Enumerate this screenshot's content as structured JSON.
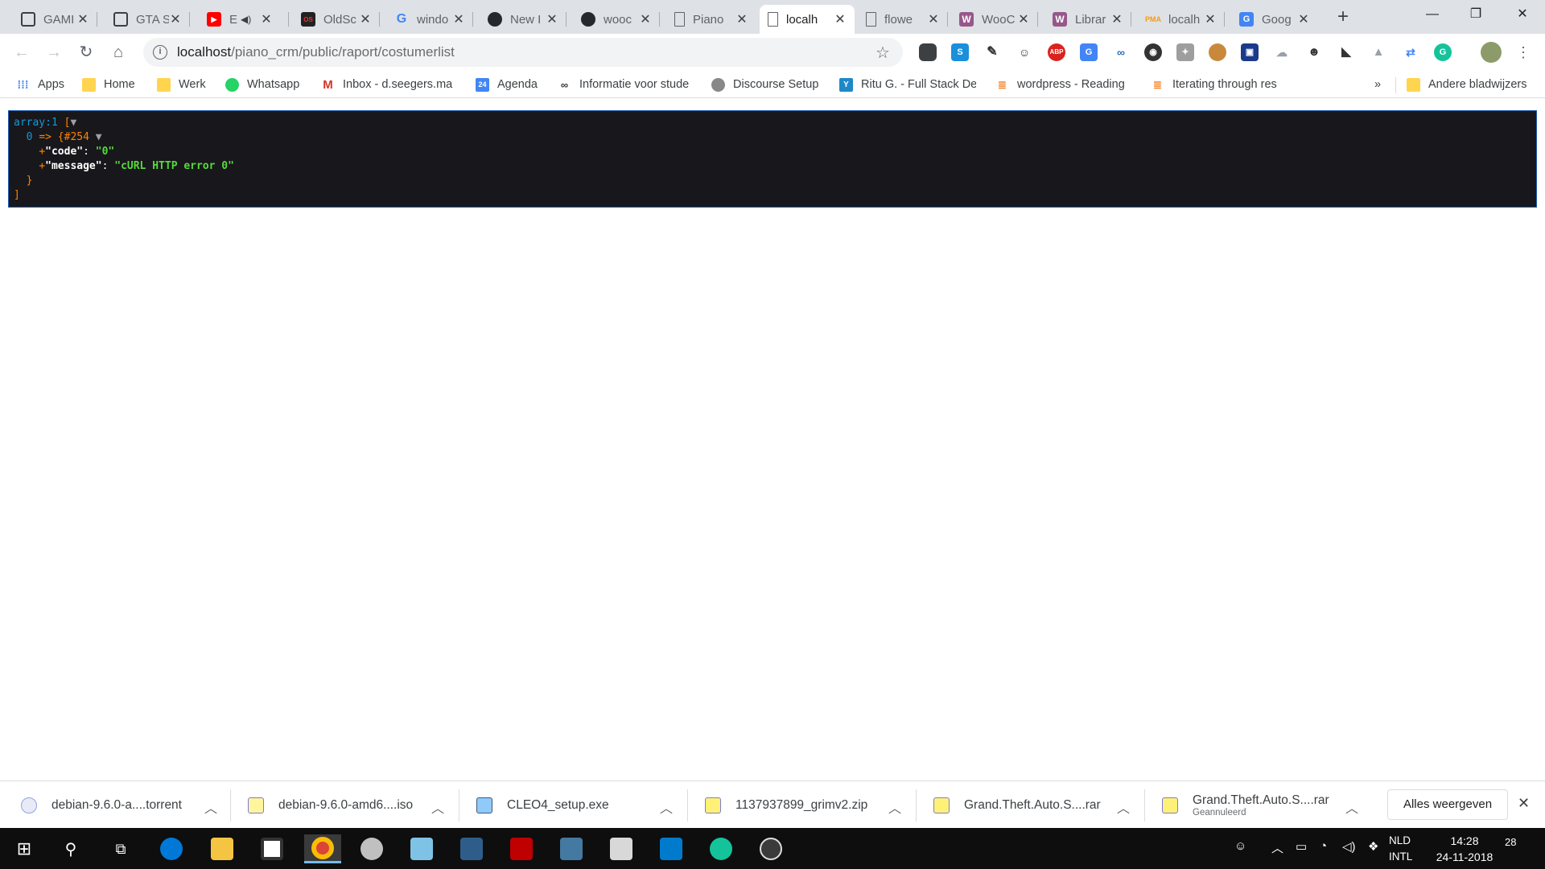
{
  "tabs": [
    {
      "title": "GAMI",
      "icon": "page-icon",
      "active": false
    },
    {
      "title": "GTA S",
      "icon": "page-icon",
      "active": false
    },
    {
      "title": "E",
      "icon": "youtube-icon",
      "active": false
    },
    {
      "title": "OldSc",
      "icon": "site-icon",
      "active": false
    },
    {
      "title": "windo",
      "icon": "google-icon",
      "active": false
    },
    {
      "title": "New I",
      "icon": "github-icon",
      "active": false
    },
    {
      "title": "wooc",
      "icon": "github-icon",
      "active": false
    },
    {
      "title": "Piano",
      "icon": "page-icon",
      "active": false
    },
    {
      "title": "localh",
      "icon": "page-icon",
      "active": true
    },
    {
      "title": "flowe",
      "icon": "page-icon",
      "active": false
    },
    {
      "title": "WooC",
      "icon": "woo-icon",
      "active": false
    },
    {
      "title": "Librar",
      "icon": "woo-icon",
      "active": false
    },
    {
      "title": "localh",
      "icon": "pma-icon",
      "active": false
    },
    {
      "title": "Goog",
      "icon": "google-translate-icon",
      "active": false
    }
  ],
  "toolbar": {
    "url_host": "localhost",
    "url_path": "/piano_crm/public/raport/costumerlist"
  },
  "bookmarks": [
    {
      "label": "Apps",
      "icon": "apps-icon"
    },
    {
      "label": "Home",
      "icon": "folder-icon"
    },
    {
      "label": "Werk",
      "icon": "folder-icon"
    },
    {
      "label": "Whatsapp",
      "icon": "whatsapp-icon"
    },
    {
      "label": "Inbox - d.seegers.ma",
      "icon": "gmail-icon"
    },
    {
      "label": "Agenda",
      "icon": "calendar-icon"
    },
    {
      "label": "Informatie voor stude",
      "icon": "glasses-icon"
    },
    {
      "label": "Discourse Setup",
      "icon": "discourse-icon"
    },
    {
      "label": "Ritu G. - Full Stack De",
      "icon": "yoast-icon"
    },
    {
      "label": "wordpress - Reading",
      "icon": "stackoverflow-icon"
    },
    {
      "label": "Iterating through res",
      "icon": "stackoverflow-icon"
    },
    {
      "label": "»",
      "icon": "chevron-icon"
    },
    {
      "label": "Andere bladwijzers",
      "icon": "folder-icon"
    }
  ],
  "dump": {
    "array_label": "array:1",
    "open_bracket": "[",
    "toggle": "▼",
    "index": "0",
    "arrow": "=>",
    "object_id": "{#254",
    "code_key": "\"code\"",
    "code_value": "\"0\"",
    "message_key": "\"message\"",
    "message_value": "\"cURL HTTP error 0\"",
    "plus": "+",
    "colon": ":",
    "close_brace": "}",
    "close_bracket": "]"
  },
  "downloads": [
    {
      "name": "debian-9.6.0-a....torrent",
      "status": ""
    },
    {
      "name": "debian-9.6.0-amd6....iso",
      "status": ""
    },
    {
      "name": "CLEO4_setup.exe",
      "status": ""
    },
    {
      "name": "1137937899_grimv2.zip",
      "status": ""
    },
    {
      "name": "Grand.Theft.Auto.S....rar",
      "status": ""
    },
    {
      "name": "Grand.Theft.Auto.S....rar",
      "status": "Geannuleerd"
    }
  ],
  "shelf": {
    "show_all": "Alles weergeven"
  },
  "taskbar": {
    "lang_top": "NLD",
    "lang_bottom": "INTL",
    "time": "14:28",
    "date": "24-11-2018",
    "notifications": "28"
  }
}
